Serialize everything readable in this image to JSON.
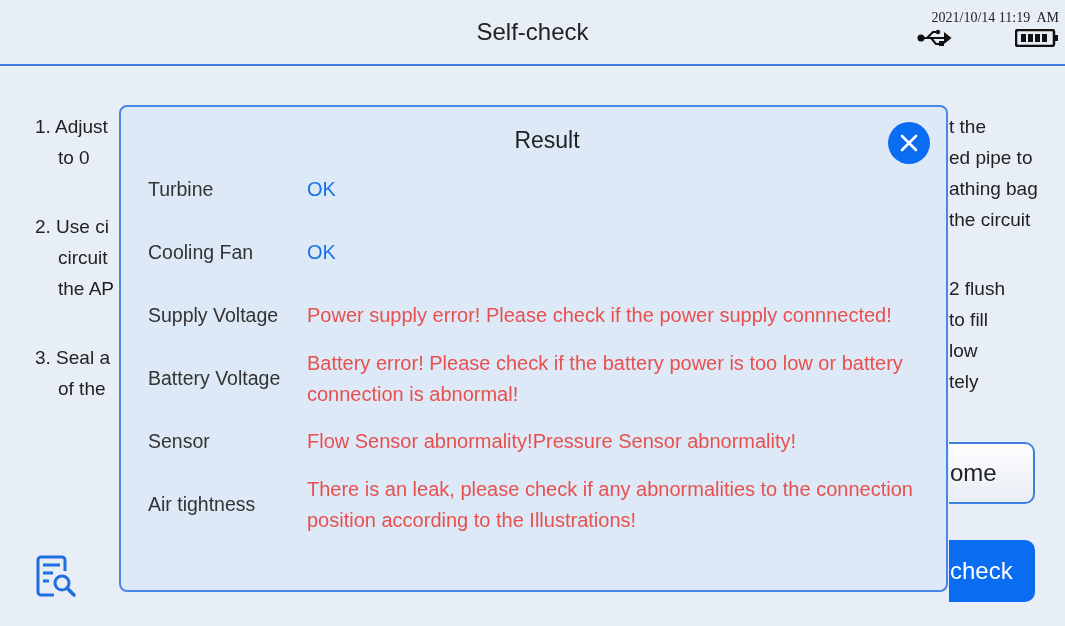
{
  "header": {
    "title": "Self-check",
    "datetime": "2021/10/14 11:19  AM"
  },
  "left_steps": [
    {
      "lines": [
        "1. Adjust",
        "to 0"
      ]
    },
    {
      "lines": [
        "2. Use ci",
        "circuit",
        "the AP"
      ]
    },
    {
      "lines": [
        "3. Seal a",
        "of the"
      ]
    }
  ],
  "right_steps": [
    {
      "lines": [
        "t the",
        "ed pipe to",
        "athing bag",
        "the circuit"
      ]
    },
    {
      "lines": [
        "2 flush",
        "to fill",
        "low",
        "tely"
      ]
    }
  ],
  "buttons": [
    {
      "label": "ome",
      "kind": "secondary"
    },
    {
      "label": "check",
      "kind": "primary"
    }
  ],
  "dialog": {
    "title": "Result",
    "rows": [
      {
        "label": "Turbine",
        "value": "OK",
        "error": false
      },
      {
        "label": "Cooling Fan",
        "value": "OK",
        "error": false
      },
      {
        "label": "Supply Voltage",
        "value": "Power supply error! Please check if the power supply connnected!",
        "error": true
      },
      {
        "label": "Battery Voltage",
        "value": "Battery error! Please check if the battery power is too low or battery connection is abnormal!",
        "error": true
      },
      {
        "label": "Sensor",
        "value": "Flow Sensor abnormality!Pressure Sensor abnormality!",
        "error": true
      },
      {
        "label": "Air tightness",
        "value": "There is an leak, please check if any abnormalities to the connection position according to the Illustrations!",
        "error": true
      }
    ]
  }
}
